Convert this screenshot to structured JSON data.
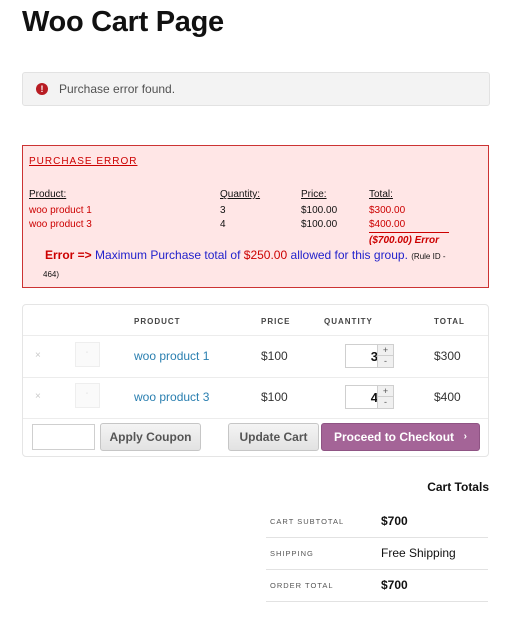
{
  "page_title": "Woo Cart Page",
  "notice": {
    "icon": "error-icon",
    "glyph": "!",
    "text": "Purchase error found."
  },
  "purchase_error": {
    "title": "PURCHASE ERROR",
    "headers": {
      "product": "Product:",
      "quantity": "Quantity:",
      "price": "Price:",
      "total": "Total:"
    },
    "rows": [
      {
        "product": "woo product 1",
        "quantity": "3",
        "price": "$100.00",
        "total": "$300.00"
      },
      {
        "product": "woo product 3",
        "quantity": "4",
        "price": "$100.00",
        "total": "$400.00"
      }
    ],
    "difference": "($700.00) Error",
    "message": {
      "prefix": "Error =>",
      "part1": "Maximum Purchase total of",
      "amount": "$250.00",
      "part2": "allowed for this group.",
      "rule_label": "(Rule ID -",
      "rule_id": "464)"
    }
  },
  "cart": {
    "columns": {
      "product": "PRODUCT",
      "price": "PRICE",
      "quantity": "QUANTITY",
      "total": "TOTAL"
    },
    "items": [
      {
        "remove": "×",
        "name": "woo product 1",
        "price": "$100",
        "qty": "3",
        "total": "$300"
      },
      {
        "remove": "×",
        "name": "woo product 3",
        "price": "$100",
        "qty": "4",
        "total": "$400"
      }
    ],
    "qty_plus": "+",
    "qty_minus": "-",
    "coupon_placeholder": "",
    "apply_coupon": "Apply Coupon",
    "update_cart": "Update Cart",
    "checkout": "Proceed to Checkout",
    "checkout_chevron": "›",
    "accent_color": "#a46497"
  },
  "totals": {
    "title": "Cart Totals",
    "subtotal_label": "CART SUBTOTAL",
    "subtotal": "$700",
    "shipping_label": "SHIPPING",
    "shipping": "Free Shipping",
    "order_total_label": "ORDER TOTAL",
    "order_total": "$700"
  }
}
